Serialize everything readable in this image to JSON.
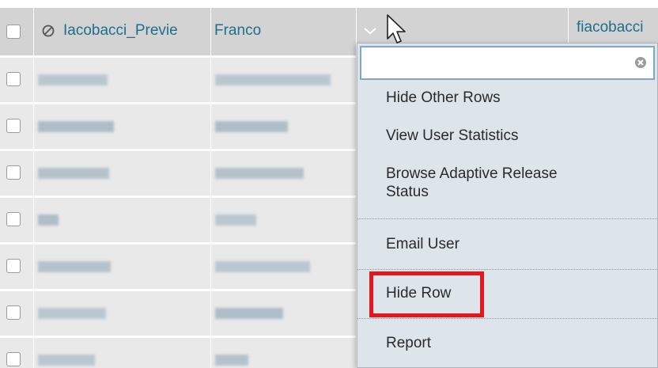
{
  "header": {
    "username": "Iacobacci_Previe",
    "first_name": "Franco",
    "email_partial": "fiacobacci"
  },
  "menu": {
    "search_placeholder": "",
    "items": [
      {
        "label": "Hide Other Rows"
      },
      {
        "label": "View User Statistics"
      },
      {
        "label": "Browse Adaptive Release\nStatus"
      },
      {
        "label": "Email User"
      },
      {
        "label": "Hide Row"
      },
      {
        "label": "Report"
      }
    ],
    "highlighted_item": "Hide Row"
  },
  "colors": {
    "header_bg": "#d3d3d3",
    "row_bg": "#e9e9e9",
    "link": "#1f6e8e",
    "menu_bg": "#dde5ea",
    "highlight_border": "#e8161b"
  },
  "icons": {
    "hidden_user": "ban-icon",
    "expand": "chevron-down-icon",
    "clear": "clear-icon",
    "pointer": "cursor-icon"
  }
}
